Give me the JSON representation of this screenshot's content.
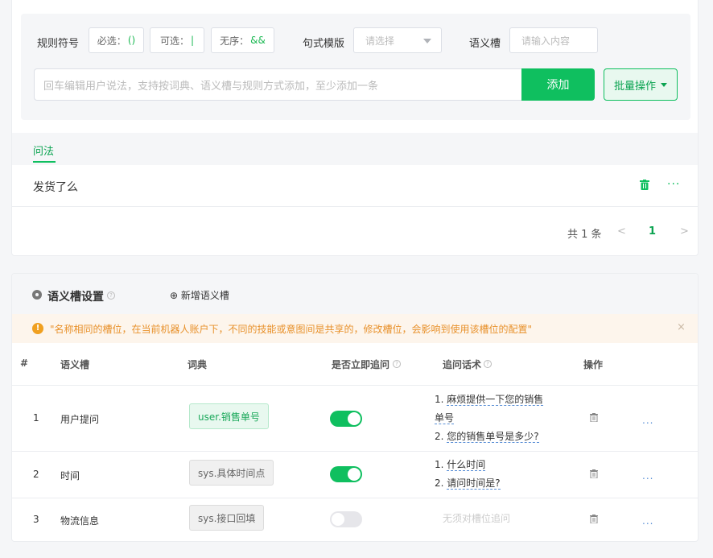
{
  "rule_bar": {
    "rule_symbol_label": "规则符号",
    "chips": [
      {
        "label": "必选：",
        "symbol": "()"
      },
      {
        "label": "可选：",
        "symbol": "|"
      },
      {
        "label": "无序：",
        "symbol": "&&"
      }
    ],
    "template_label": "句式模版",
    "template_placeholder": "请选择",
    "slot_label": "语义槽",
    "slot_placeholder": "请输入内容",
    "main_placeholder": "回车编辑用户说法，支持按词典、语义槽与规则方式添加，至少添加一条",
    "add_button": "添加",
    "batch_button": "批量操作"
  },
  "tabs": [
    {
      "label": "问法"
    }
  ],
  "questions": [
    {
      "text": "发货了么"
    }
  ],
  "pagination": {
    "total_text": "共 1 条",
    "current": "1",
    "prev": "<",
    "next": ">"
  },
  "slot_section": {
    "title": "语义槽设置",
    "add_label": "新增语义槽",
    "warning": "\"名称相同的槽位，在当前机器人账户下，不同的技能或意图间是共享的，修改槽位，会影响到使用该槽位的配置\"",
    "close": "×",
    "columns": [
      "#",
      "语义槽",
      "词典",
      "是否立即追问",
      "追问话术",
      "操作"
    ],
    "rows": [
      {
        "index": "1",
        "slot": "用户提问",
        "dict": "user.销售单号",
        "dict_style": "green",
        "ask_now": true,
        "prompts": [
          "1. ",
          "麻烦提供一下您的销售",
          "单号",
          "2. ",
          "您的销售单号是多少?"
        ],
        "more": "..."
      },
      {
        "index": "2",
        "slot": "时间",
        "dict": "sys.具体时间点",
        "dict_style": "gray",
        "ask_now": true,
        "prompts": [
          "1. ",
          "什么时间",
          "2. ",
          "请问时间是?"
        ],
        "more": "..."
      },
      {
        "index": "3",
        "slot": "物流信息",
        "dict": "sys.接口回填",
        "dict_style": "gray",
        "ask_now": false,
        "no_prompt": "无须对槽位追问",
        "more": "..."
      }
    ]
  },
  "icons": {
    "question_dots": "···",
    "qmark": "?",
    "warn": "!",
    "add_circle": "⊕"
  }
}
